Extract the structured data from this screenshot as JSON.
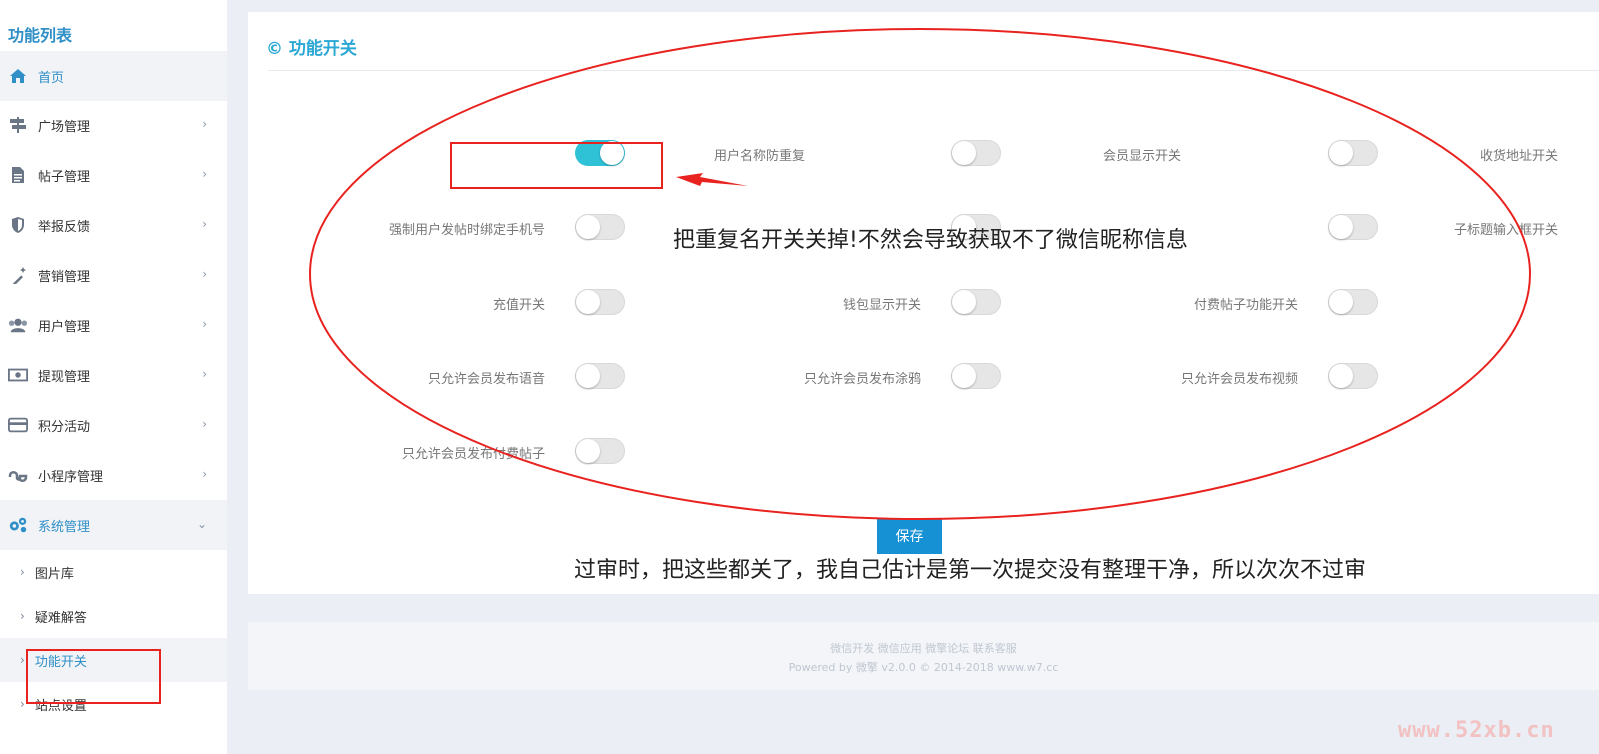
{
  "sidebar": {
    "title": "功能列表",
    "items": [
      {
        "label": "首页",
        "icon": "home-icon"
      },
      {
        "label": "广场管理",
        "icon": "signpost-icon"
      },
      {
        "label": "帖子管理",
        "icon": "document-icon"
      },
      {
        "label": "举报反馈",
        "icon": "shield-icon"
      },
      {
        "label": "营销管理",
        "icon": "magic-wand-icon"
      },
      {
        "label": "用户管理",
        "icon": "users-icon"
      },
      {
        "label": "提现管理",
        "icon": "money-icon"
      },
      {
        "label": "积分活动",
        "icon": "credit-card-icon"
      },
      {
        "label": "小程序管理",
        "icon": "stumbleupon-icon"
      },
      {
        "label": "系统管理",
        "icon": "gears-icon"
      }
    ],
    "sub_items": [
      {
        "label": "图片库"
      },
      {
        "label": "疑难解答"
      },
      {
        "label": "功能开关"
      },
      {
        "label": "站点设置"
      }
    ]
  },
  "panel": {
    "title": "© 功能开关",
    "save_label": "保存"
  },
  "switches": [
    {
      "label": "用户名称防重复",
      "on": true
    },
    {
      "label": "会员显示开关",
      "on": false
    },
    {
      "label": "收货地址开关",
      "on": false
    },
    {
      "label": "强制用户发帖时绑定手机号",
      "on": false
    },
    {
      "label": "",
      "on": false
    },
    {
      "label": "子标题输入框开关",
      "on": false
    },
    {
      "label": "充值开关",
      "on": false
    },
    {
      "label": "钱包显示开关",
      "on": false
    },
    {
      "label": "付费帖子功能开关",
      "on": false
    },
    {
      "label": "只允许会员发布语音",
      "on": false
    },
    {
      "label": "只允许会员发布涂鸦",
      "on": false
    },
    {
      "label": "只允许会员发布视频",
      "on": false
    },
    {
      "label": "只允许会员发布付费帖子",
      "on": false
    }
  ],
  "annotations": {
    "note1": "把重复名开关关掉!不然会导致获取不了微信昵称信息",
    "note2": "过审时，把这些都关了，我自己估计是第一次提交没有整理干净，所以次次不过审",
    "color": "#e8231f"
  },
  "footer": {
    "links": "微信开发 微信应用 微擎论坛 联系客服",
    "copyright": "Powered by 微擎 v2.0.0 © 2014-2018 www.w7.cc"
  },
  "watermark": "www.52xb.cn",
  "colors": {
    "accent": "#2f8fc6",
    "toggle_on": "#2fc1d6",
    "button": "#1591d4"
  }
}
